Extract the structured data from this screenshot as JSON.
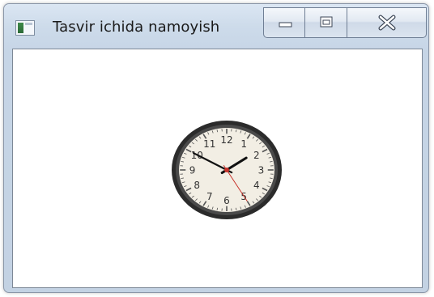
{
  "window": {
    "title": "Tasvir ichida namoyish",
    "app_icon": "window-app-icon",
    "buttons": {
      "minimize_icon": "minimize-icon",
      "maximize_icon": "maximize-icon",
      "close_icon": "close-icon"
    }
  },
  "clock": {
    "numerals": [
      "12",
      "1",
      "2",
      "3",
      "4",
      "5",
      "6",
      "7",
      "8",
      "9",
      "10",
      "11"
    ],
    "time": {
      "hour": 1,
      "minute": 50,
      "second": 25
    },
    "colors": {
      "rim": "#2b2b2b",
      "face": "#f2eee4",
      "hands": "#111111",
      "second_hand": "#c8322a"
    }
  }
}
